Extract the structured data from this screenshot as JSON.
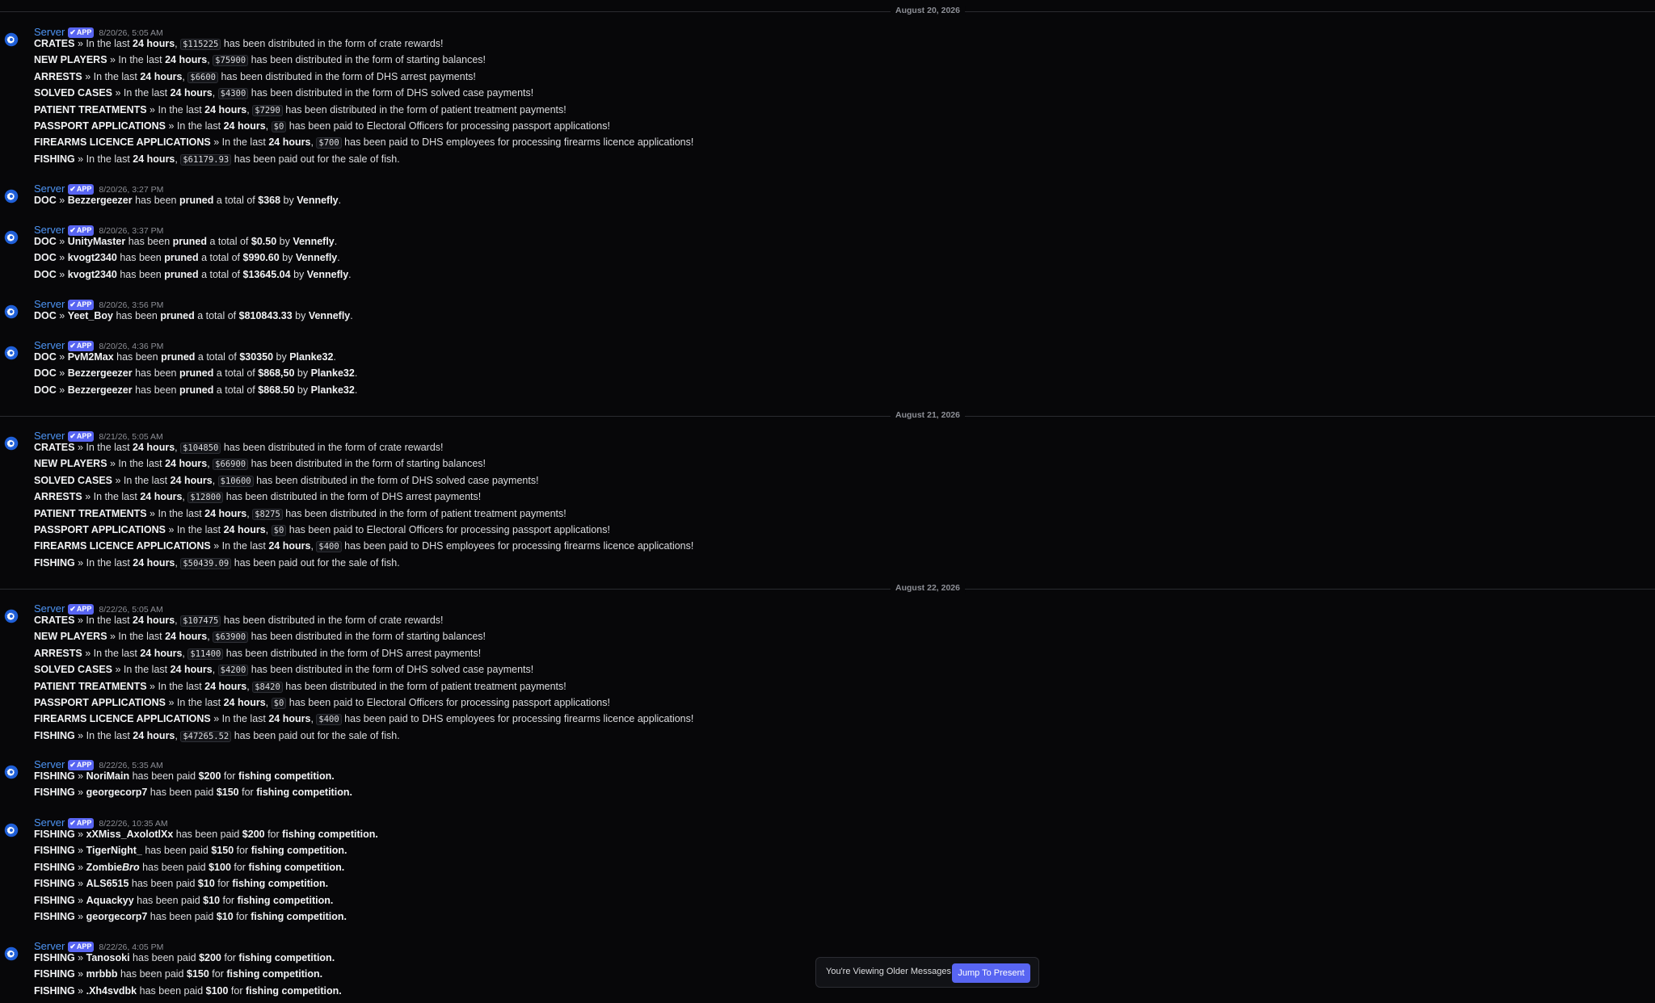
{
  "bot": {
    "author": "Server",
    "badge": "APP"
  },
  "jump_bar": {
    "label": "You're Viewing Older Messages",
    "button": "Jump To Present"
  },
  "dividers": [
    {
      "label": "August 20, 2026"
    },
    {
      "label": "August 21, 2026"
    },
    {
      "label": "August 22, 2026"
    }
  ],
  "messages": [
    {
      "time": "8/20/26, 5:05 AM",
      "lines": [
        "<b>CRATES</b> » In the last <b>24 hours</b>, <code>$115225</code> has been distributed in the form of crate rewards!",
        "<b>NEW PLAYERS</b> » In the last <b>24 hours</b>, <code>$75900</code> has been distributed in the form of starting balances!",
        "<b>ARRESTS</b> » In the last <b>24 hours</b>, <code>$6600</code> has been distributed in the form of DHS arrest payments!",
        "<b>SOLVED CASES</b> » In the last <b>24 hours</b>, <code>$4300</code> has been distributed in the form of DHS solved case payments!",
        "<b>PATIENT TREATMENTS</b> » In the last <b>24 hours</b>, <code>$7290</code> has been distributed in the form of patient treatment payments!",
        "<b>PASSPORT APPLICATIONS</b> » In the last <b>24 hours</b>, <code>$0</code> has been paid to Electoral Officers for processing passport applications!",
        "<b>FIREARMS LICENCE APPLICATIONS</b> » In the last <b>24 hours</b>, <code>$700</code> has been paid to DHS employees for processing firearms licence applications!",
        "<b>FISHING</b> » In the last <b>24 hours</b>, <code>$61179.93</code> has been paid out for the sale of fish."
      ]
    },
    {
      "time": "8/20/26, 3:27 PM",
      "lines": [
        "<b>DOC</b> » <b>Bezzergeezer</b> has been <b>pruned</b> a total of <b>$368</b> by <b>Vennefly</b>."
      ]
    },
    {
      "time": "8/20/26, 3:37 PM",
      "lines": [
        "<b>DOC</b> » <b>UnityMaster</b> has been <b>pruned</b> a total of <b>$0.50</b> by <b>Vennefly</b>.",
        "<b>DOC</b> » <b>kvogt2340</b> has been <b>pruned</b> a total of <b>$990.60</b> by <b>Vennefly</b>.",
        "<b>DOC</b> » <b>kvogt2340</b> has been <b>pruned</b> a total of <b>$13645.04</b> by <b>Vennefly</b>."
      ]
    },
    {
      "time": "8/20/26, 3:56 PM",
      "lines": [
        "<b>DOC</b> » <b>Yeet_Boy</b> has been <b>pruned</b> a total of <b>$810843.33</b> by <b>Vennefly</b>."
      ]
    },
    {
      "time": "8/20/26, 4:36 PM",
      "lines": [
        "<b>DOC</b> » <b>PvM2Max</b> has been <b>pruned</b> a total of <b>$30350</b> by <b>Planke32</b>.",
        "<b>DOC</b> » <b>Bezzergeezer</b> has been <b>pruned</b> a total of <b>$868,50</b> by <b>Planke32</b>.",
        "<b>DOC</b> » <b>Bezzergeezer</b> has been <b>pruned</b> a total of <b>$868.50</b> by <b>Planke32</b>."
      ]
    },
    {
      "time": "8/21/26, 5:05 AM",
      "lines": [
        "<b>CRATES</b> » In the last <b>24 hours</b>, <code>$104850</code> has been distributed in the form of crate rewards!",
        "<b>NEW PLAYERS</b> » In the last <b>24 hours</b>, <code>$66900</code> has been distributed in the form of starting balances!",
        "<b>SOLVED CASES</b> » In the last <b>24 hours</b>, <code>$10600</code> has been distributed in the form of DHS solved case payments!",
        "<b>ARRESTS</b> » In the last <b>24 hours</b>, <code>$12800</code> has been distributed in the form of DHS arrest payments!",
        "<b>PATIENT TREATMENTS</b> » In the last <b>24 hours</b>, <code>$8275</code> has been distributed in the form of patient treatment payments!",
        "<b>PASSPORT APPLICATIONS</b> » In the last <b>24 hours</b>, <code>$0</code> has been paid to Electoral Officers for processing passport applications!",
        "<b>FIREARMS LICENCE APPLICATIONS</b> » In the last <b>24 hours</b>, <code>$400</code> has been paid to DHS employees for processing firearms licence applications!",
        "<b>FISHING</b> » In the last <b>24 hours</b>, <code>$50439.09</code> has been paid out for the sale of fish."
      ]
    },
    {
      "time": "8/22/26, 5:05 AM",
      "lines": [
        "<b>CRATES</b> » In the last <b>24 hours</b>, <code>$107475</code> has been distributed in the form of crate rewards!",
        "<b>NEW PLAYERS</b> » In the last <b>24 hours</b>, <code>$63900</code> has been distributed in the form of starting balances!",
        "<b>ARRESTS</b> » In the last <b>24 hours</b>, <code>$11400</code> has been distributed in the form of DHS arrest payments!",
        "<b>SOLVED CASES</b> » In the last <b>24 hours</b>, <code>$4200</code> has been distributed in the form of DHS solved case payments!",
        "<b>PATIENT TREATMENTS</b> » In the last <b>24 hours</b>, <code>$8420</code> has been distributed in the form of patient treatment payments!",
        "<b>PASSPORT APPLICATIONS</b> » In the last <b>24 hours</b>, <code>$0</code> has been paid to Electoral Officers for processing passport applications!",
        "<b>FIREARMS LICENCE APPLICATIONS</b> » In the last <b>24 hours</b>, <code>$400</code> has been paid to DHS employees for processing firearms licence applications!",
        "<b>FISHING</b> » In the last <b>24 hours</b>, <code>$47265.52</code> has been paid out for the sale of fish."
      ]
    },
    {
      "time": "8/22/26, 5:35 AM",
      "lines": [
        "<b>FISHING</b> » <b>NoriMain</b> has been paid <b>$200</b> for <b>fishing competition.</b>",
        "<b>FISHING</b> » <b>georgecorp7</b> has been paid <b>$150</b> for <b>fishing competition.</b>"
      ]
    },
    {
      "time": "8/22/26, 10:35 AM",
      "lines": [
        "<b>FISHING</b> » <b>xXMiss_AxolotlXx</b> has been paid <b>$200</b> for <b>fishing competition.</b>",
        "<b>FISHING</b> » <b>TigerNight_</b> has been paid <b>$150</b> for <b>fishing competition.</b>",
        "<b>FISHING</b> » <b>Zombie<i>Bro</i></b> has been paid <b>$100</b> for <b>fishing competition.</b>",
        "<b>FISHING</b> » <b>ALS6515</b> has been paid <b>$10</b> for <b>fishing competition.</b>",
        "<b>FISHING</b> » <b>Aquackyy</b> has been paid <b>$10</b> for <b>fishing competition.</b>",
        "<b>FISHING</b> » <b>georgecorp7</b> has been paid <b>$10</b> for <b>fishing competition.</b>"
      ]
    },
    {
      "time": "8/22/26, 4:05 PM",
      "lines": [
        "<b>FISHING</b> » <b>Tanosoki</b> has been paid <b>$200</b> for <b>fishing competition.</b>",
        "<b>FISHING</b> » <b>mrbbb</b> has been paid <b>$150</b> for <b>fishing competition.</b>",
        "<b>FISHING</b> » <b>.Xh4svdbk</b> has been paid <b>$100</b> for <b>fishing competition.</b>"
      ]
    }
  ]
}
